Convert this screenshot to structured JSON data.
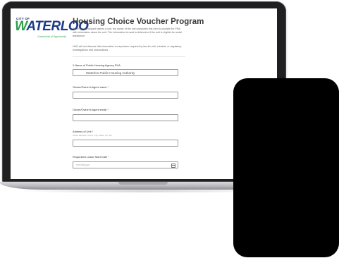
{
  "logo": {
    "city": "CITY OF",
    "word_first": "W",
    "word_rest": "ATERLOO",
    "tagline": "Community of Opportunity"
  },
  "form": {
    "title": "Housing Choice Voucher Program",
    "intro": "When the participant selects a unit, the owner of the unit completes this form to provide the PHA with information about the unit. The information is used to determine if the unit is eligible for rental assistance.",
    "notice": "HUD will not disclose this information except when required by law for civil, criminal, or regulatory investigations and prosecutions."
  },
  "questions": [
    {
      "label": "1.Name of Public Housing Agency PHA",
      "required": false,
      "value": "Waterloo Public Housing Authority"
    },
    {
      "label": "Owner/Owner's Agent name",
      "required": true,
      "value": ""
    },
    {
      "label": "Owner/Owner's Agent email",
      "required": true,
      "value": ""
    },
    {
      "label": "Address of Unit",
      "required": true,
      "hint": "Street address, Unit #, City, State, zip, Zip",
      "value": ""
    },
    {
      "label": "Requested Lease Start Date",
      "required": true,
      "placeholder": "mm/dd/yyyy",
      "value": ""
    }
  ],
  "required_mark": "*"
}
